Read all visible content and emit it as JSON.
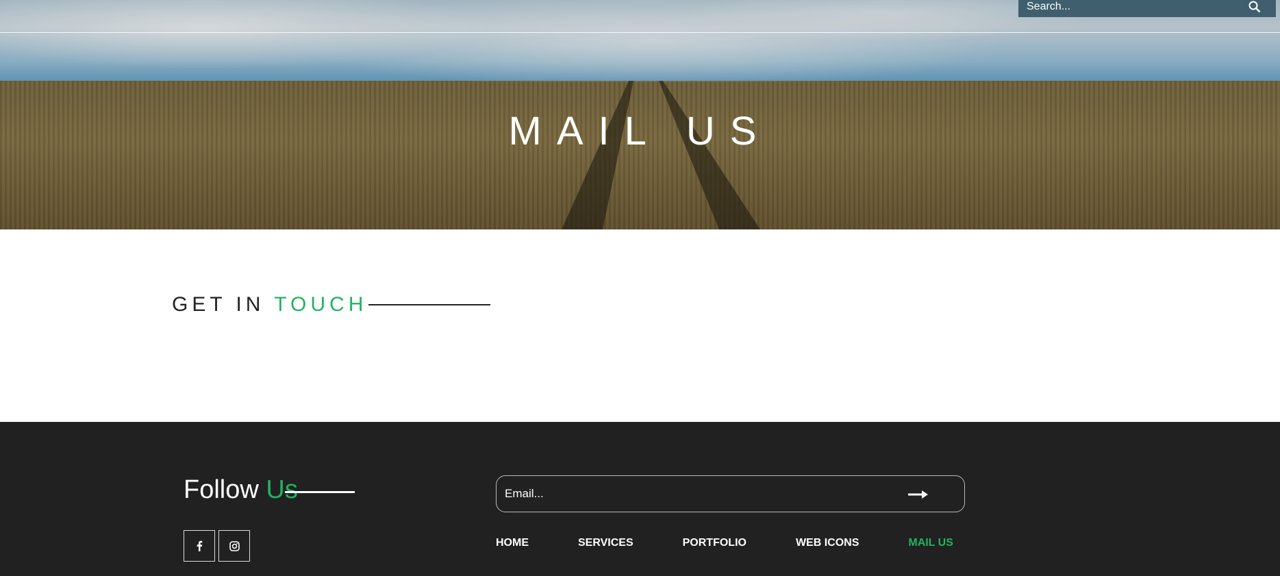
{
  "header": {
    "search": {
      "placeholder": "Search...",
      "icon": "search-icon"
    }
  },
  "hero": {
    "title": "MAIL US"
  },
  "contact": {
    "heading_plain": "GET IN ",
    "heading_accent": "TOUCH"
  },
  "footer": {
    "follow_plain": "Follow ",
    "follow_accent": "Us",
    "socials": [
      {
        "icon": "facebook-icon"
      },
      {
        "icon": "instagram-icon"
      }
    ],
    "email": {
      "placeholder": "Email...",
      "submit_icon": "arrow-right-icon"
    },
    "nav": [
      {
        "label": "HOME",
        "active": false
      },
      {
        "label": "SERVICES",
        "active": false
      },
      {
        "label": "PORTFOLIO",
        "active": false
      },
      {
        "label": "WEB ICONS",
        "active": false
      },
      {
        "label": "MAIL US",
        "active": true
      }
    ]
  },
  "colors": {
    "accent": "#22b35f",
    "footer_bg": "#212121",
    "text_dark": "#222222"
  }
}
